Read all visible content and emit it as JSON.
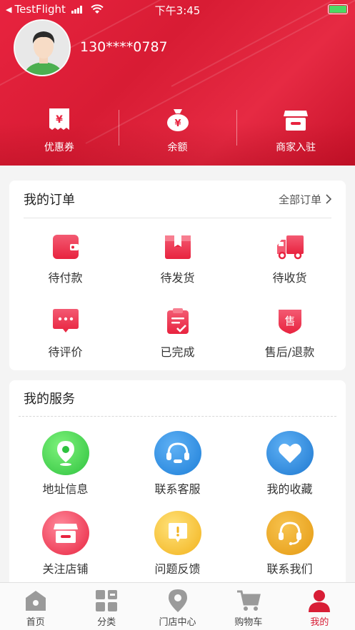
{
  "status_bar": {
    "back_app": "TestFlight",
    "time": "下午3:45"
  },
  "profile": {
    "phone": "130****0787"
  },
  "quick_actions": [
    {
      "label": "优惠券",
      "icon": "coupon-icon"
    },
    {
      "label": "余额",
      "icon": "money-bag-icon"
    },
    {
      "label": "商家入驻",
      "icon": "store-icon"
    }
  ],
  "orders": {
    "title": "我的订单",
    "all_label": "全部订单",
    "items": [
      {
        "label": "待付款",
        "icon": "wallet-icon"
      },
      {
        "label": "待发货",
        "icon": "box-icon"
      },
      {
        "label": "待收货",
        "icon": "truck-icon"
      },
      {
        "label": "待评价",
        "icon": "comment-icon"
      },
      {
        "label": "已完成",
        "icon": "clipboard-check-icon"
      },
      {
        "label": "售后/退款",
        "icon": "after-sales-icon"
      }
    ]
  },
  "services": {
    "title": "我的服务",
    "items": [
      {
        "label": "地址信息",
        "icon": "location-icon"
      },
      {
        "label": "联系客服",
        "icon": "headset-icon"
      },
      {
        "label": "我的收藏",
        "icon": "heart-icon"
      },
      {
        "label": "关注店铺",
        "icon": "shop-icon"
      },
      {
        "label": "问题反馈",
        "icon": "feedback-icon"
      },
      {
        "label": "联系我们",
        "icon": "support-icon"
      }
    ]
  },
  "tabbar": [
    {
      "label": "首页",
      "icon": "home-icon",
      "active": false
    },
    {
      "label": "分类",
      "icon": "category-icon",
      "active": false
    },
    {
      "label": "门店中心",
      "icon": "location-pin-icon",
      "active": false
    },
    {
      "label": "购物车",
      "icon": "cart-icon",
      "active": false
    },
    {
      "label": "我的",
      "icon": "user-icon",
      "active": true
    }
  ],
  "colors": {
    "brand_red": "#e8233f",
    "active_tab": "#d81e36"
  },
  "order_icon_glyphs": {
    "after_sales": "售"
  }
}
